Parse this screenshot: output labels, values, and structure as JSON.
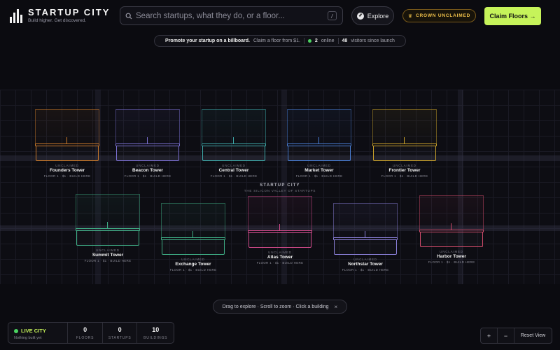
{
  "brand": {
    "name": "STARTUP CITY",
    "tagline": "Build higher. Get discovered."
  },
  "search": {
    "placeholder": "Search startups, what they do, or a floor...",
    "shortcut": "/"
  },
  "explore": {
    "label": "Explore",
    "icon": "compass-icon"
  },
  "crown": {
    "label": "CROWN UNCLAIMED",
    "icon": "crown-icon",
    "color": "#f0c14a"
  },
  "claim": {
    "label": "Claim Floors →",
    "color": "#c6f35a"
  },
  "promo": {
    "headline": "Promote your startup on a billboard.",
    "offer": "Claim a floor from $1.",
    "online_count": "2",
    "online_label": "online",
    "visitors_count": "48",
    "visitors_label": "visitors since launch"
  },
  "city": {
    "title": "STARTUP CITY",
    "subtitle": "THE SILICON VALLEY OF STARTUPS"
  },
  "towers": [
    {
      "name": "Founders Tower",
      "status": "UNCLAIMED",
      "sub": "FLOOR 1 · $1 · BUILD HERE",
      "color": "#c9792a"
    },
    {
      "name": "Beacon Tower",
      "status": "UNCLAIMED",
      "sub": "FLOOR 1 · $1 · BUILD HERE",
      "color": "#7a6fd0"
    },
    {
      "name": "Central Tower",
      "status": "UNCLAIMED",
      "sub": "FLOOR 1 · $1 · BUILD HERE",
      "color": "#3ea9a9"
    },
    {
      "name": "Market Tower",
      "status": "UNCLAIMED",
      "sub": "FLOOR 1 · $1 · BUILD HERE",
      "color": "#4a7fd6"
    },
    {
      "name": "Frontier Tower",
      "status": "UNCLAIMED",
      "sub": "FLOOR 1 · $1 · BUILD HERE",
      "color": "#c9a12a"
    },
    {
      "name": "Summit Tower",
      "status": "UNCLAIMED",
      "sub": "FLOOR 1 · $1 · BUILD HERE",
      "color": "#3fae85"
    },
    {
      "name": "Exchange Tower",
      "status": "UNCLAIMED",
      "sub": "FLOOR 1 · $1 · BUILD HERE",
      "color": "#3fae85"
    },
    {
      "name": "Atlas Tower",
      "status": "UNCLAIMED",
      "sub": "FLOOR 1 · $1 · BUILD HERE",
      "color": "#d04a8a"
    },
    {
      "name": "Northstar Tower",
      "status": "UNCLAIMED",
      "sub": "FLOOR 1 · $1 · BUILD HERE",
      "color": "#8a7fd8"
    },
    {
      "name": "Harbor Tower",
      "status": "UNCLAIMED",
      "sub": "FLOOR 1 · $1 · BUILD HERE",
      "color": "#d04a6a"
    }
  ],
  "hint": {
    "text": "Drag to explore · Scroll to zoom · Click a building",
    "close": "×"
  },
  "stats": {
    "live_label": "LIVE CITY",
    "live_sub": "Nothing built yet",
    "floors_value": "0",
    "floors_label": "FLOORS",
    "startups_value": "0",
    "startups_label": "STARTUPS",
    "buildings_value": "10",
    "buildings_label": "BUILDINGS"
  },
  "zoom": {
    "in": "+",
    "out": "−",
    "reset": "Reset View"
  }
}
